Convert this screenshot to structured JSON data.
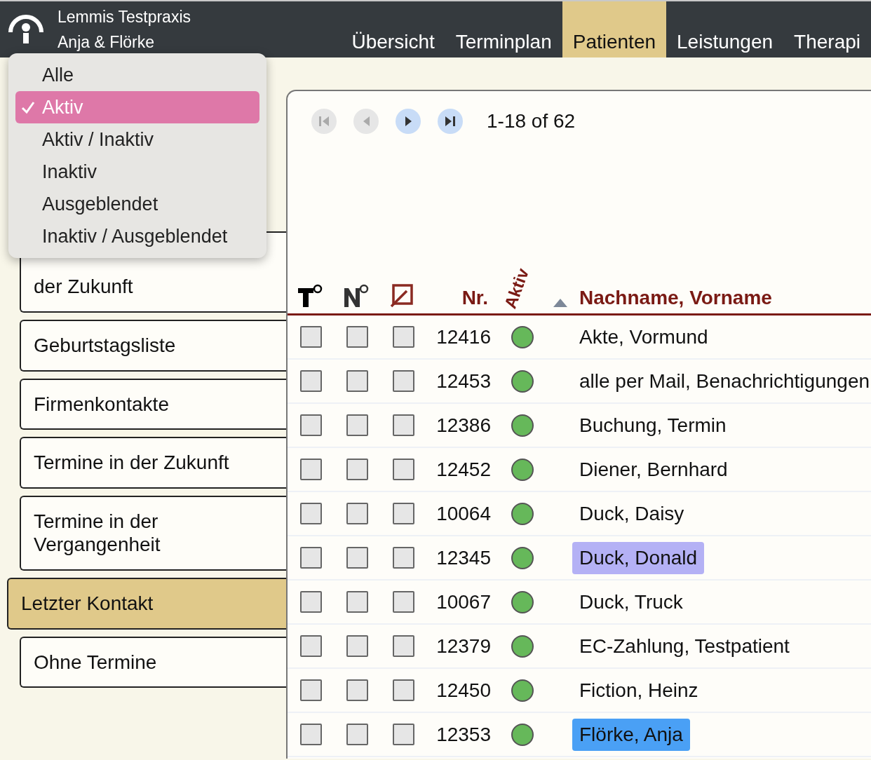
{
  "header": {
    "title": "Lemmis Testpraxis",
    "subtitle": "Anja & Flörke"
  },
  "nav": [
    {
      "label": "Übersicht",
      "selected": false
    },
    {
      "label": "Terminplan",
      "selected": false
    },
    {
      "label": "Patienten",
      "selected": true
    },
    {
      "label": "Leistungen",
      "selected": false
    },
    {
      "label": "Therapi",
      "selected": false
    }
  ],
  "filter_menu": [
    {
      "label": "Alle",
      "selected": false
    },
    {
      "label": "Aktiv",
      "selected": true
    },
    {
      "label": "Aktiv / Inaktiv",
      "selected": false
    },
    {
      "label": "Inaktiv",
      "selected": false
    },
    {
      "label": "Ausgeblendet",
      "selected": false
    },
    {
      "label": "Inaktiv / Ausgeblendet",
      "selected": false
    }
  ],
  "sidebar": [
    {
      "label": "der Zukunft",
      "selected": false,
      "kind": "cut"
    },
    {
      "label": "Geburtstagsliste",
      "selected": false
    },
    {
      "label": "Firmenkontakte",
      "selected": false
    },
    {
      "label": "Termine in der Zukunft",
      "selected": false
    },
    {
      "label": "Termine in der Vergangenheit",
      "selected": false
    },
    {
      "label": "Letzter Kontakt",
      "selected": true
    },
    {
      "label": "Ohne Termine",
      "selected": false
    }
  ],
  "pager": {
    "buttons": [
      {
        "kind": "first",
        "disabled": true
      },
      {
        "kind": "prev",
        "disabled": true
      },
      {
        "kind": "next",
        "disabled": false
      },
      {
        "kind": "last",
        "disabled": false
      }
    ],
    "range": "1-18 of 62"
  },
  "table": {
    "columns": [
      "Nr.",
      "Aktiv",
      "Nachname, Vorname"
    ],
    "rows": [
      {
        "col1": false,
        "col2": false,
        "col3": false,
        "nr": "12416",
        "color": "#66b85a",
        "name": "Akte, Vormund"
      },
      {
        "col1": false,
        "col2": false,
        "col3": false,
        "nr": "12453",
        "color": "#66b85a",
        "name": "alle per Mail, Benachrichtigungen"
      },
      {
        "col1": false,
        "col2": false,
        "col3": false,
        "nr": "12386",
        "color": "#66b85a",
        "name": "Buchung, Termin"
      },
      {
        "col1": false,
        "col2": false,
        "col3": false,
        "nr": "12452",
        "color": "#66b85a",
        "name": "Diener, Bernhard"
      },
      {
        "col1": false,
        "col2": false,
        "col3": false,
        "nr": "10064",
        "color": "#66b85a",
        "name": "Duck, Daisy"
      },
      {
        "col1": false,
        "col2": false,
        "col3": false,
        "nr": "12345",
        "color": "#66b85a",
        "name": "Duck, Donald",
        "highlight": {
          "color": "#b4b1f5"
        }
      },
      {
        "col1": false,
        "col2": false,
        "col3": false,
        "nr": "10067",
        "color": "#66b85a",
        "name": "Duck, Truck"
      },
      {
        "col1": false,
        "col2": false,
        "col3": false,
        "nr": "12379",
        "color": "#66b85a",
        "name": "EC-Zahlung, Testpatient"
      },
      {
        "col1": false,
        "col2": false,
        "col3": false,
        "nr": "12450",
        "color": "#66b85a",
        "name": "Fiction, Heinz"
      },
      {
        "col1": false,
        "col2": false,
        "col3": false,
        "nr": "12353",
        "color": "#66b85a",
        "name": "Flörke, Anja",
        "highlight": {
          "color": "#4aa0f5"
        }
      }
    ]
  }
}
